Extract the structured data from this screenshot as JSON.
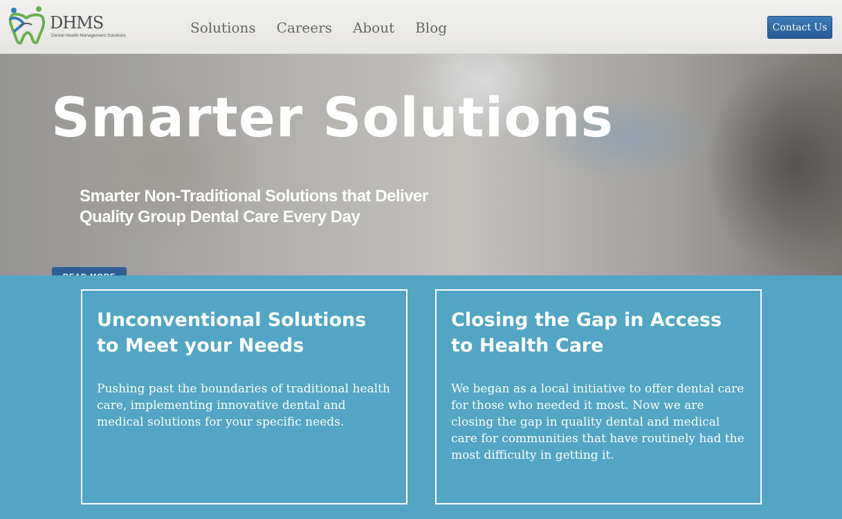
{
  "brand": {
    "logo_text": "DHMS",
    "logo_subtitle": "Dental Health Management Solutions"
  },
  "nav": {
    "items": [
      "Solutions",
      "Careers",
      "About",
      "Blog"
    ]
  },
  "header": {
    "contact_label": "Contact Us"
  },
  "hero": {
    "title": "Smarter Solutions",
    "subtitle": "Smarter Non-Traditional Solutions that Deliver Quality Group Dental Care Every Day",
    "button_label": "READ MORE"
  },
  "cards": [
    {
      "title": "Unconventional Solutions to Meet your Needs",
      "body": "Pushing past the boundaries of traditional health care, implementing innovative dental and medical solutions for your specific needs."
    },
    {
      "title": "Closing the Gap in Access to Health Care",
      "body": "We began as a local initiative to offer dental care for those who needed it most. Now we are closing the gap in quality dental and medical care for communities that have routinely had the most difficulty in getting it."
    }
  ],
  "colors": {
    "section_bg": "#52a5c4",
    "button_blue": "#2d5f93"
  }
}
